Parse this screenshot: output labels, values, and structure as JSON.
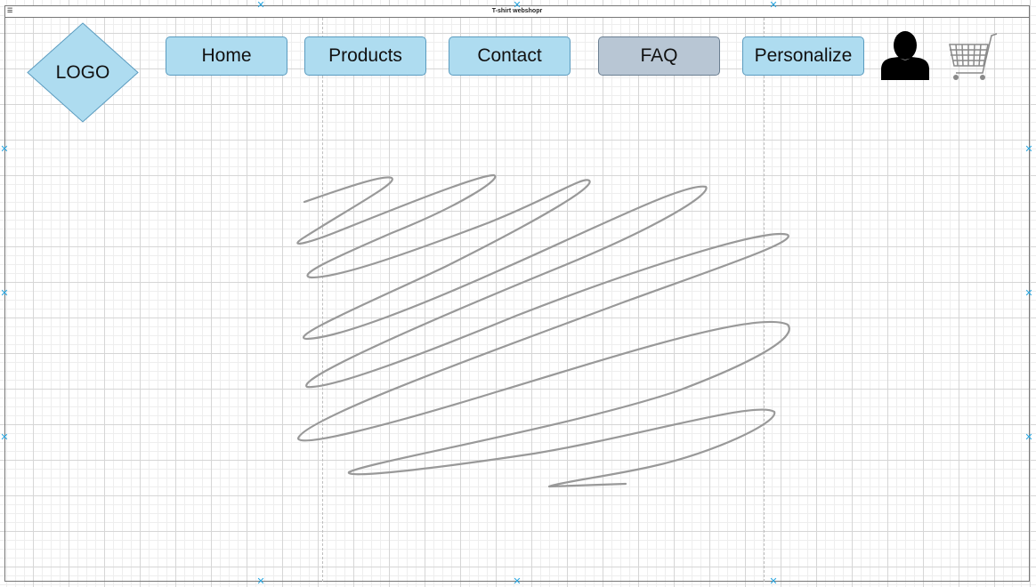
{
  "window": {
    "title": "T-shirt webshopr"
  },
  "logo": {
    "label": "LOGO"
  },
  "nav": {
    "home": "Home",
    "products": "Products",
    "contact": "Contact",
    "faq": "FAQ",
    "personalize": "Personalize",
    "active": "faq"
  },
  "icons": {
    "user": "user-icon",
    "cart": "cart-icon"
  },
  "colors": {
    "button_fill": "#aedcf0",
    "button_active_fill": "#b8c6d4",
    "handle": "#2aa6e0",
    "scribble": "#999999"
  }
}
